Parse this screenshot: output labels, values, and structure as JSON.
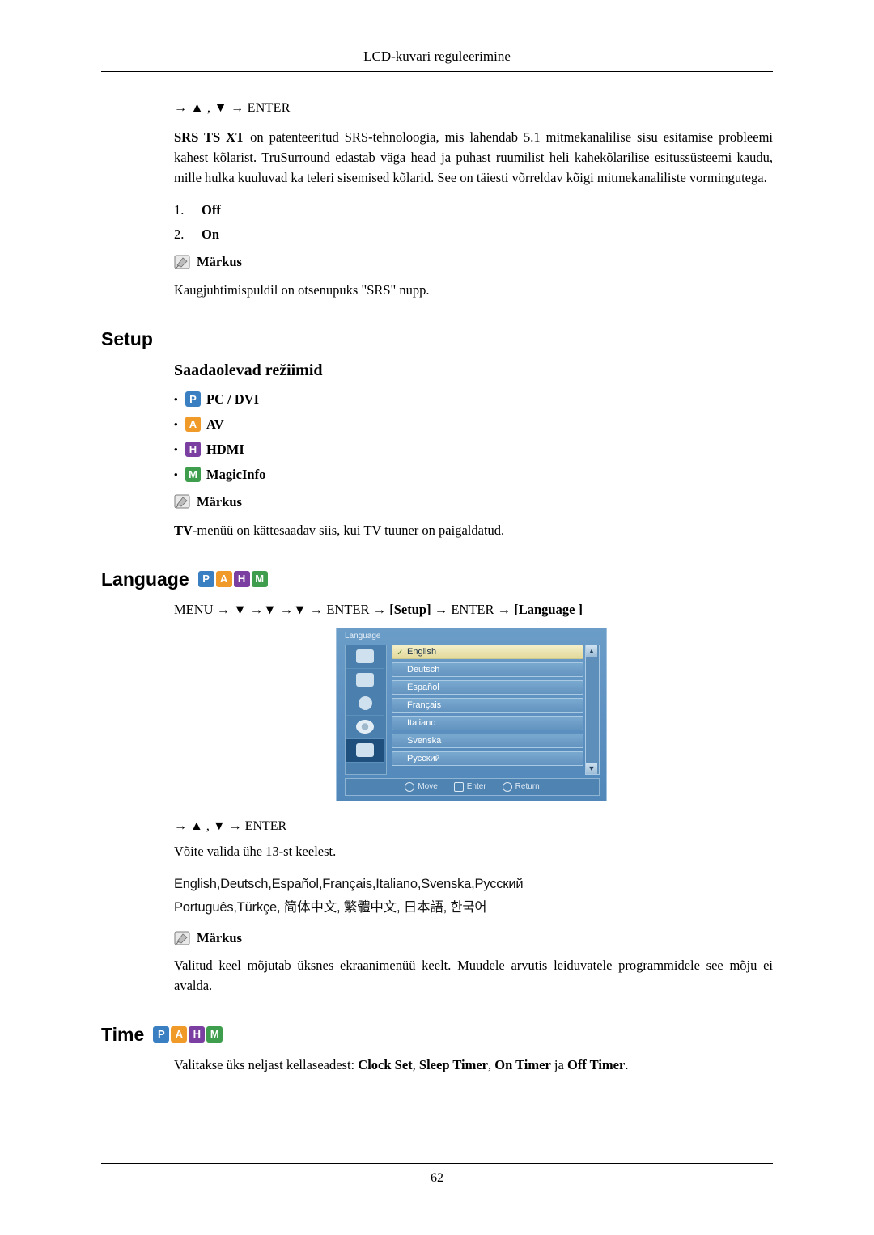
{
  "header": {
    "running_title": "LCD-kuvari reguleerimine",
    "page_number": "62"
  },
  "srs_section": {
    "key_hint": "→ ▲ , ▼ → ENTER",
    "bold_lead": "SRS TS XT",
    "paragraph": " on patenteeritud SRS-tehnoloogia, mis lahendab 5.1 mitmekanalilise sisu esitamise probleemi kahest kõlarist. TruSurround edastab väga head ja puhast ruumilist heli kahekõlarilise esitussüsteemi kaudu, mille hulka kuuluvad ka teleri sisemised kõlarid. See on täiesti võrreldav kõigi mitmekanaliliste vormingutega.",
    "options": [
      {
        "num": "1.",
        "label": "Off"
      },
      {
        "num": "2.",
        "label": "On"
      }
    ],
    "note_label": "Märkus",
    "note_text": "Kaugjuhtimispuldil on otsenupuks \"SRS\" nupp."
  },
  "setup_section": {
    "title": "Setup",
    "subtitle": "Saadaolevad režiimid",
    "modes": [
      {
        "tag": "P",
        "label": "PC / DVI",
        "color": "#3a7fc1"
      },
      {
        "tag": "A",
        "label": "AV",
        "color": "#f09a2a"
      },
      {
        "tag": "H",
        "label": "HDMI",
        "color": "#7a3fa0"
      },
      {
        "tag": "M",
        "label": "MagicInfo",
        "color": "#3f9e4d"
      }
    ],
    "note_label": "Märkus",
    "note_text_bold": "TV",
    "note_text": "-menüü on kättesaadav siis, kui TV tuuner on paigaldatud."
  },
  "language_section": {
    "title": "Language",
    "tags": [
      "P",
      "A",
      "H",
      "M"
    ],
    "menu_path_plain": "MENU → ▼ →▼ →▼ → ENTER → ",
    "menu_path_setup": "[Setup]",
    "menu_path_mid": " → ENTER → ",
    "menu_path_language": "[Language ]",
    "osd": {
      "title": "Language",
      "items": [
        {
          "label": "English",
          "checked": true,
          "active": true
        },
        {
          "label": "Deutsch",
          "checked": false,
          "active": false
        },
        {
          "label": "Español",
          "checked": false,
          "active": false
        },
        {
          "label": "Français",
          "checked": false,
          "active": false
        },
        {
          "label": "Italiano",
          "checked": false,
          "active": false
        },
        {
          "label": "Svenska",
          "checked": false,
          "active": false
        },
        {
          "label": "Русский",
          "checked": false,
          "active": false
        }
      ],
      "scroll_up": "▲",
      "scroll_down": "▼",
      "bar": [
        {
          "label": "Move"
        },
        {
          "label": "Enter"
        },
        {
          "label": "Return"
        }
      ]
    },
    "key_hint": "→ ▲ , ▼ → ENTER",
    "caption": "Võite valida ühe 13-st keelest.",
    "lang_line_1": "English,Deutsch,Español,Français,Italiano,Svenska,Русский",
    "lang_line_2": "Português,Türkçe, 简体中文,  繁體中文, 日本語, 한국어",
    "note_label": "Märkus",
    "note_text": "Valitud keel mõjutab üksnes ekraanimenüü keelt. Muudele arvutis leiduvatele programmidele see mõju ei avalda."
  },
  "time_section": {
    "title": "Time",
    "tags": [
      "P",
      "A",
      "H",
      "M"
    ],
    "lead": "Valitakse üks neljast kellaseadest: ",
    "items": [
      "Clock Set",
      "Sleep Timer",
      "On Timer",
      "Off Timer"
    ],
    "sep_1": ", ",
    "sep_2": ", ",
    "sep_3": " ja ",
    "tail": "."
  }
}
